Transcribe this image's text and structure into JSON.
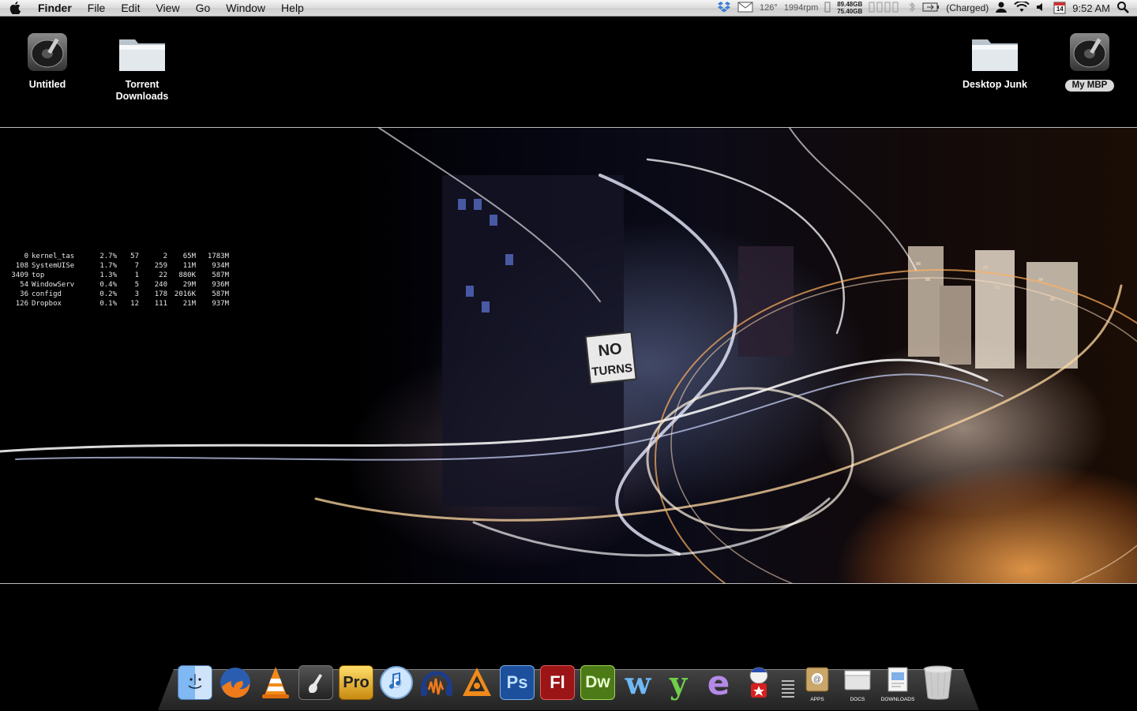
{
  "menubar": {
    "app_name": "Finder",
    "menus": [
      "File",
      "Edit",
      "View",
      "Go",
      "Window",
      "Help"
    ],
    "status": {
      "temperature": "126°",
      "fan": "1994rpm",
      "disk_top": "89.48GB",
      "disk_bottom": "75.40GB",
      "battery": "(Charged)",
      "calendar_day": "14",
      "clock": "9:52 AM"
    }
  },
  "desktop": {
    "icons_left": [
      {
        "label": "Untitled",
        "kind": "hard-drive-icon"
      },
      {
        "label": "Torrent\nDownloads",
        "kind": "folder-icon"
      }
    ],
    "icons_right": [
      {
        "label": "Desktop Junk",
        "kind": "folder-icon"
      },
      {
        "label": "My MBP",
        "kind": "hard-drive-icon",
        "selected": true
      }
    ]
  },
  "top_widget": {
    "rows": [
      {
        "pid": "0",
        "cmd": "kernel_tas",
        "cpu": "2.7%",
        "th": "57",
        "ports": "2",
        "mem": "65M",
        "vsize": "1783M"
      },
      {
        "pid": "108",
        "cmd": "SystemUISe",
        "cpu": "1.7%",
        "th": "7",
        "ports": "259",
        "mem": "11M",
        "vsize": "934M"
      },
      {
        "pid": "3409",
        "cmd": "top",
        "cpu": "1.3%",
        "th": "1",
        "ports": "22",
        "mem": "880K",
        "vsize": "587M"
      },
      {
        "pid": "54",
        "cmd": "WindowServ",
        "cpu": "0.4%",
        "th": "5",
        "ports": "240",
        "mem": "29M",
        "vsize": "936M"
      },
      {
        "pid": "36",
        "cmd": "configd",
        "cpu": "0.2%",
        "th": "3",
        "ports": "178",
        "mem": "2016K",
        "vsize": "587M"
      },
      {
        "pid": "126",
        "cmd": "Dropbox",
        "cpu": "0.1%",
        "th": "12",
        "ports": "111",
        "mem": "21M",
        "vsize": "937M"
      }
    ]
  },
  "wallpaper": {
    "sign_line1": "NO",
    "sign_line2": "TURNS"
  },
  "dock": {
    "apps": [
      {
        "name": "finder-icon"
      },
      {
        "name": "firefox-icon"
      },
      {
        "name": "vlc-icon"
      },
      {
        "name": "garageband-icon"
      },
      {
        "name": "pro-app-icon",
        "text": "Pro"
      },
      {
        "name": "itunes-icon"
      },
      {
        "name": "audacity-icon"
      },
      {
        "name": "reason-icon"
      },
      {
        "name": "photoshop-icon",
        "text": "Ps"
      },
      {
        "name": "flash-icon",
        "text": "Fl"
      },
      {
        "name": "dreamweaver-icon",
        "text": "Dw"
      },
      {
        "name": "wunderkit-icon",
        "text": "w"
      },
      {
        "name": "textwrangler-icon",
        "text": "y"
      },
      {
        "name": "e-editor-icon",
        "text": "e"
      },
      {
        "name": "transmission-icon"
      }
    ],
    "stacks": [
      {
        "label": "APPS",
        "icon": "apps-stack-icon"
      },
      {
        "label": "DOCS",
        "icon": "docs-stack-icon"
      },
      {
        "label": "DOWNLOADS",
        "icon": "downloads-stack-icon"
      }
    ],
    "trash": "trash-icon"
  }
}
